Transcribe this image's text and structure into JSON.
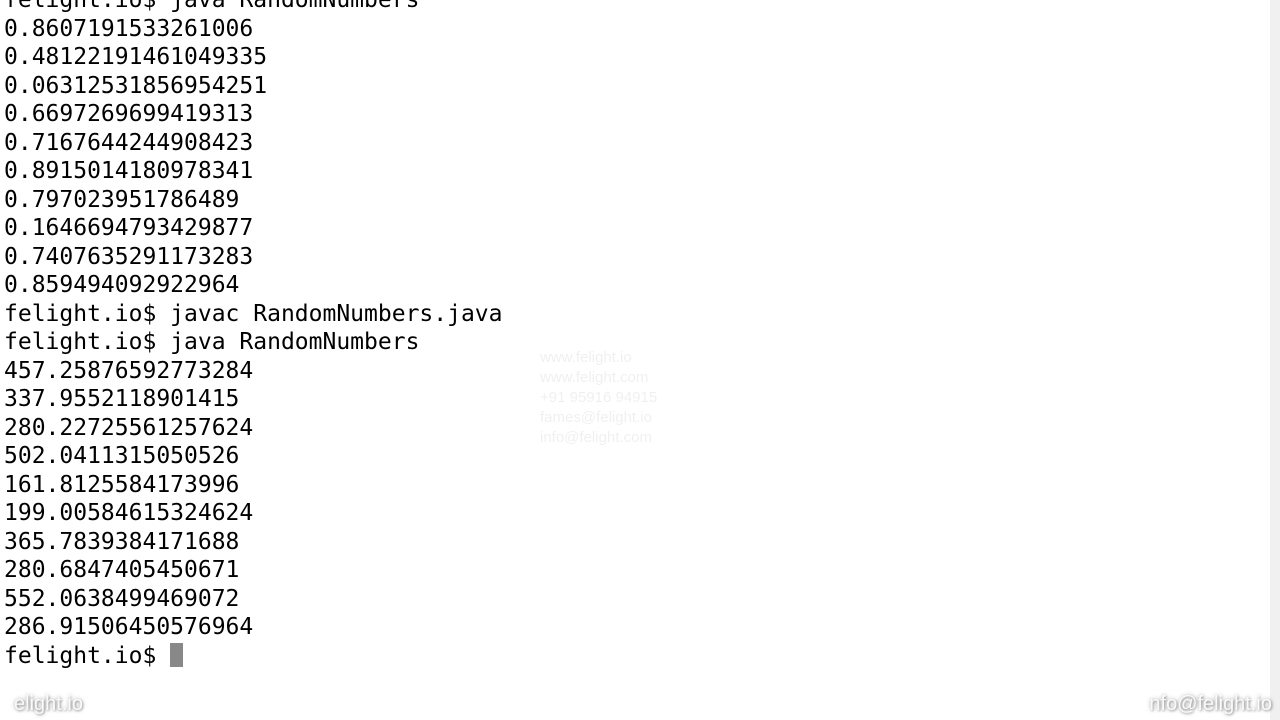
{
  "terminal": {
    "lines": [
      {
        "text": "felight.io$ java RandomNumbers",
        "cutTop": true
      },
      {
        "text": "0.8607191533261006"
      },
      {
        "text": "0.48122191461049335"
      },
      {
        "text": "0.06312531856954251"
      },
      {
        "text": "0.6697269699419313"
      },
      {
        "text": "0.7167644244908423"
      },
      {
        "text": "0.8915014180978341"
      },
      {
        "text": "0.797023951786489"
      },
      {
        "text": "0.1646694793429877"
      },
      {
        "text": "0.7407635291173283"
      },
      {
        "text": "0.859494092922964"
      },
      {
        "text": "felight.io$ javac RandomNumbers.java"
      },
      {
        "text": "felight.io$ java RandomNumbers"
      },
      {
        "text": "457.25876592773284"
      },
      {
        "text": "337.9552118901415",
        "selFull": true
      },
      {
        "text": "280.22725561257624",
        "selFull": true
      },
      {
        "text": "502.0411315050526",
        "selFull": true
      },
      {
        "text": "161.8125584173996",
        "selFull": true
      },
      {
        "text": "199.00584615324624",
        "selPartialChars": 12
      },
      {
        "text": "365.7839384171688"
      },
      {
        "text": "280.6847405450671"
      },
      {
        "text": "552.0638499469072"
      },
      {
        "text": "286.91506450576964"
      },
      {
        "text": "felight.io$ ",
        "cursor": true
      }
    ]
  },
  "watermark_center": {
    "l1": "www.felight.io",
    "l2": "www.felight.com",
    "l3": "+91 95916 94915",
    "l4": "fames@felight.io",
    "l5": "info@felight.com"
  },
  "footer": {
    "left": "elight.io",
    "right": "nfo@felight.io"
  }
}
